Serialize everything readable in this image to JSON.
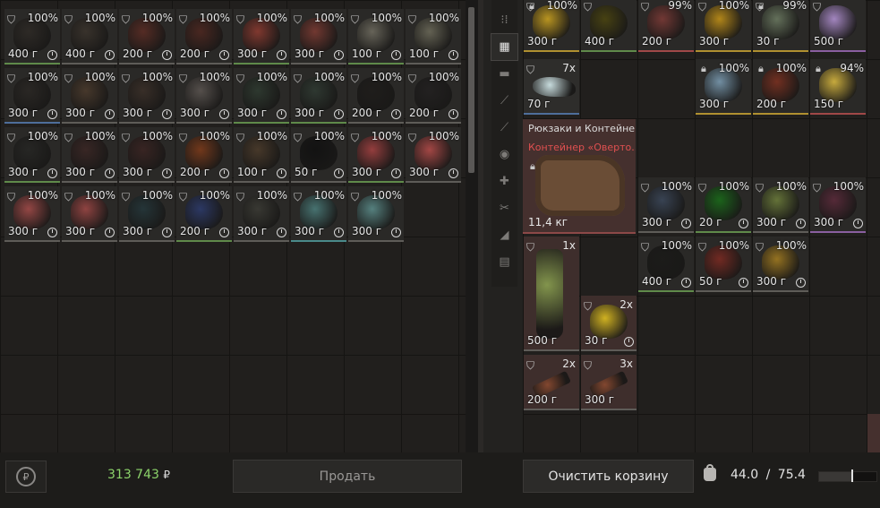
{
  "trader_sell": {
    "money": "313 743",
    "currency": "₽",
    "sell_label": "Продать",
    "items": [
      {
        "pct": "100%",
        "w": "400 г",
        "rar": "g",
        "col": "#2e2a26"
      },
      {
        "pct": "100%",
        "w": "400 г",
        "rar": "",
        "col": "#3a332c"
      },
      {
        "pct": "100%",
        "w": "200 г",
        "rar": "",
        "col": "#5a2c24"
      },
      {
        "pct": "100%",
        "w": "200 г",
        "rar": "",
        "col": "#4d2720"
      },
      {
        "pct": "100%",
        "w": "300 г",
        "rar": "g",
        "col": "#8a3a30"
      },
      {
        "pct": "100%",
        "w": "300 г",
        "rar": "",
        "col": "#7a3a32"
      },
      {
        "pct": "100%",
        "w": "100 г",
        "rar": "g",
        "col": "#6d6a5e"
      },
      {
        "pct": "100%",
        "w": "100 г",
        "rar": "",
        "col": "#6a6858"
      },
      {
        "pct": "100%",
        "w": "300 г",
        "rar": "b",
        "col": "#2a2724"
      },
      {
        "pct": "100%",
        "w": "300 г",
        "rar": "",
        "col": "#4a3a2c"
      },
      {
        "pct": "100%",
        "w": "300 г",
        "rar": "",
        "col": "#3a2f28"
      },
      {
        "pct": "100%",
        "w": "300 г",
        "rar": "",
        "col": "#5a5450"
      },
      {
        "pct": "100%",
        "w": "300 г",
        "rar": "g",
        "col": "#2e3a30"
      },
      {
        "pct": "100%",
        "w": "300 г",
        "rar": "g",
        "col": "#2f3a32"
      },
      {
        "pct": "100%",
        "w": "200 г",
        "rar": "",
        "col": "#1e1c1a"
      },
      {
        "pct": "100%",
        "w": "200 г",
        "rar": "",
        "col": "#222020"
      },
      {
        "pct": "100%",
        "w": "300 г",
        "rar": "g",
        "col": "#262624"
      },
      {
        "pct": "100%",
        "w": "300 г",
        "rar": "",
        "col": "#3a2624"
      },
      {
        "pct": "100%",
        "w": "300 г",
        "rar": "",
        "col": "#3a2422"
      },
      {
        "pct": "100%",
        "w": "200 г",
        "rar": "",
        "col": "#7a3a1a"
      },
      {
        "pct": "100%",
        "w": "100 г",
        "rar": "",
        "col": "#4a3a2a"
      },
      {
        "pct": "100%",
        "w": "50 г",
        "rar": "",
        "col": "#101010"
      },
      {
        "pct": "100%",
        "w": "300 г",
        "rar": "g",
        "col": "#a04040"
      },
      {
        "pct": "100%",
        "w": "300 г",
        "rar": "",
        "col": "#b04a48"
      },
      {
        "pct": "100%",
        "w": "300 г",
        "rar": "",
        "col": "#a04a48"
      },
      {
        "pct": "100%",
        "w": "300 г",
        "rar": "",
        "col": "#9a4644"
      },
      {
        "pct": "100%",
        "w": "300 г",
        "rar": "",
        "col": "#24363a"
      },
      {
        "pct": "100%",
        "w": "200 г",
        "rar": "g",
        "col": "#2c3a6a"
      },
      {
        "pct": "100%",
        "w": "300 г",
        "rar": "",
        "col": "#3a3a34"
      },
      {
        "pct": "100%",
        "w": "300 г",
        "rar": "c",
        "col": "#4a7a78"
      },
      {
        "pct": "100%",
        "w": "300 г",
        "rar": "",
        "col": "#5a8a88"
      }
    ]
  },
  "categories": [
    "list-icon",
    "grid-icon",
    "armor-icon",
    "weapon-icon",
    "ammo-icon",
    "grenade-icon",
    "medkit-icon",
    "tools-icon",
    "parts-icon",
    "container-icon"
  ],
  "categories_glyph": [
    "⁝⁞",
    "▦",
    "▬",
    "⟋",
    "⟋",
    "◉",
    "✚",
    "✂",
    "◢",
    "▤"
  ],
  "basket": {
    "clear_label": "Очистить корзину",
    "weight_current": "44.0",
    "weight_sep": "/",
    "weight_max": "75.4",
    "weight_fill": 0.58,
    "backpack": {
      "title": "Рюкзаки и Контейне...",
      "name": "Контейнер «Оверто...",
      "weight": "11,4 кг"
    },
    "row_top": [
      {
        "pct": "100%",
        "w": "300 г",
        "lock": true,
        "rar": "y",
        "col": "#c8a020"
      },
      {
        "pct": "",
        "w": "400 г",
        "lock": false,
        "rar": "g",
        "col": "#4a4410"
      },
      {
        "pct": "99%",
        "w": "200 г",
        "lock": false,
        "rar": "r",
        "col": "#7a3a36"
      },
      {
        "pct": "100%",
        "w": "300 г",
        "lock": false,
        "rar": "y",
        "col": "#c09018"
      },
      {
        "pct": "99%",
        "w": "30 г",
        "lock": true,
        "rar": "y",
        "col": "#6a7860"
      },
      {
        "pct": "",
        "w": "500 г",
        "lock": false,
        "rar": "p",
        "col": "#b090d0"
      }
    ],
    "ice": {
      "count": "7x",
      "w": "70 г"
    },
    "row_two": [
      {
        "pct": "100%",
        "w": "300 г",
        "lock": true,
        "rar": "y",
        "col": "#7a9ab0"
      },
      {
        "pct": "100%",
        "w": "200 г",
        "lock": true,
        "rar": "y",
        "col": "#7a3020"
      },
      {
        "pct": "94%",
        "w": "150 г",
        "lock": true,
        "rar": "r",
        "col": "#d8b840"
      }
    ],
    "row_mid": [
      {
        "pct": "100%",
        "w": "300 г",
        "rar": "",
        "col": "#3a4658"
      },
      {
        "pct": "100%",
        "w": "20 г",
        "rar": "g",
        "col": "#1a6a1a"
      },
      {
        "pct": "100%",
        "w": "300 г",
        "rar": "",
        "col": "#6a7a3a"
      },
      {
        "pct": "100%",
        "w": "300 г",
        "rar": "p",
        "col": "#5a2a3a"
      }
    ],
    "row_mid2": [
      {
        "pct": "100%",
        "w": "400 г",
        "rar": "g",
        "col": "#1a1a18"
      },
      {
        "pct": "100%",
        "w": "50 г",
        "rar": "",
        "col": "#7a2a22"
      },
      {
        "pct": "100%",
        "w": "300 г",
        "rar": "",
        "col": "#a07a20"
      }
    ],
    "bottle": {
      "count": "1x",
      "w": "500 г"
    },
    "cheese": {
      "count": "2x",
      "w": "30 г"
    },
    "guns": [
      {
        "count": "2x",
        "w": "200 г"
      },
      {
        "count": "3x",
        "w": "300 г"
      }
    ]
  }
}
